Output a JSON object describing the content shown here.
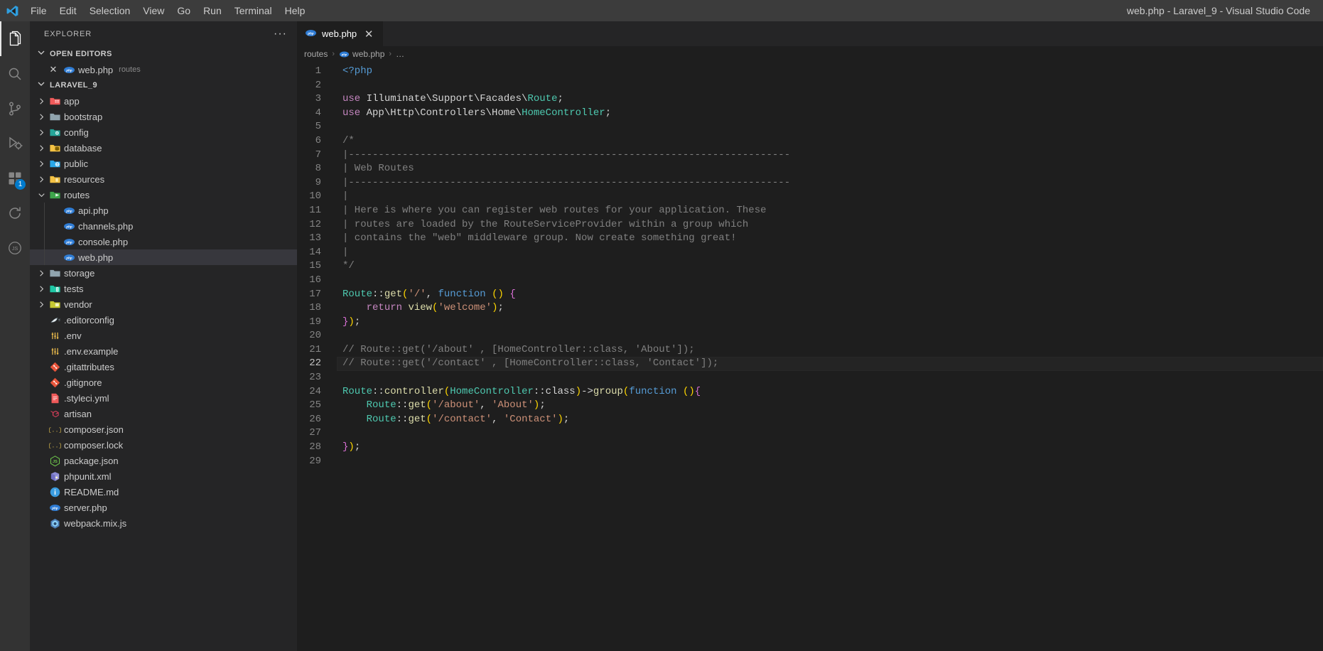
{
  "window": {
    "title": "web.php - Laravel_9 - Visual Studio Code",
    "logo_icon": "vscode-logo-icon"
  },
  "menubar": {
    "items": [
      {
        "label": "File"
      },
      {
        "label": "Edit"
      },
      {
        "label": "Selection"
      },
      {
        "label": "View"
      },
      {
        "label": "Go"
      },
      {
        "label": "Run"
      },
      {
        "label": "Terminal"
      },
      {
        "label": "Help"
      }
    ]
  },
  "activitybar": {
    "items": [
      {
        "name": "explorer",
        "icon": "files-icon",
        "active": true,
        "badge": ""
      },
      {
        "name": "search",
        "icon": "search-icon",
        "active": false,
        "badge": ""
      },
      {
        "name": "source-control",
        "icon": "source-control-icon",
        "active": false,
        "badge": ""
      },
      {
        "name": "run-and-debug",
        "icon": "run-debug-icon",
        "active": false,
        "badge": ""
      },
      {
        "name": "extensions",
        "icon": "extensions-icon",
        "active": false,
        "badge": "1"
      },
      {
        "name": "sync",
        "icon": "sync-icon",
        "active": false,
        "badge": ""
      },
      {
        "name": "json-tools",
        "icon": "json-icon",
        "active": false,
        "badge": ""
      }
    ]
  },
  "sidebar": {
    "title": "EXPLORER",
    "more_label": "···",
    "open_editors": {
      "label": "OPEN EDITORS",
      "expanded": true,
      "items": [
        {
          "name": "web.php",
          "folder": "routes",
          "icon": "php-file-icon",
          "close_label": "✕"
        }
      ]
    },
    "workspace": {
      "label": "LARAVEL_9",
      "expanded": true,
      "items": [
        {
          "label": "app",
          "type": "folder",
          "icon": "folder-app-icon",
          "expanded": false,
          "depth": 1
        },
        {
          "label": "bootstrap",
          "type": "folder",
          "icon": "folder-plain-icon",
          "expanded": false,
          "depth": 1
        },
        {
          "label": "config",
          "type": "folder",
          "icon": "folder-config-icon",
          "expanded": false,
          "depth": 1
        },
        {
          "label": "database",
          "type": "folder",
          "icon": "folder-database-icon",
          "expanded": false,
          "depth": 1
        },
        {
          "label": "public",
          "type": "folder",
          "icon": "folder-public-icon",
          "expanded": false,
          "depth": 1
        },
        {
          "label": "resources",
          "type": "folder",
          "icon": "folder-resource-icon",
          "expanded": false,
          "depth": 1
        },
        {
          "label": "routes",
          "type": "folder",
          "icon": "folder-routes-icon",
          "expanded": true,
          "depth": 1
        },
        {
          "label": "api.php",
          "type": "file",
          "icon": "php-file-icon",
          "depth": 2
        },
        {
          "label": "channels.php",
          "type": "file",
          "icon": "php-file-icon",
          "depth": 2
        },
        {
          "label": "console.php",
          "type": "file",
          "icon": "php-file-icon",
          "depth": 2
        },
        {
          "label": "web.php",
          "type": "file",
          "icon": "php-file-icon",
          "depth": 2,
          "selected": true
        },
        {
          "label": "storage",
          "type": "folder",
          "icon": "folder-plain-icon",
          "expanded": false,
          "depth": 1
        },
        {
          "label": "tests",
          "type": "folder",
          "icon": "folder-tests-icon",
          "expanded": false,
          "depth": 1
        },
        {
          "label": "vendor",
          "type": "folder",
          "icon": "folder-vendor-icon",
          "expanded": false,
          "depth": 1
        },
        {
          "label": ".editorconfig",
          "type": "file",
          "icon": "editorconfig-icon",
          "depth": 1
        },
        {
          "label": ".env",
          "type": "file",
          "icon": "env-icon",
          "depth": 1
        },
        {
          "label": ".env.example",
          "type": "file",
          "icon": "env-icon",
          "depth": 1
        },
        {
          "label": ".gitattributes",
          "type": "file",
          "icon": "git-icon",
          "depth": 1
        },
        {
          "label": ".gitignore",
          "type": "file",
          "icon": "git-icon",
          "depth": 1
        },
        {
          "label": ".styleci.yml",
          "type": "file",
          "icon": "yml-icon",
          "depth": 1
        },
        {
          "label": "artisan",
          "type": "file",
          "icon": "laravel-icon",
          "depth": 1
        },
        {
          "label": "composer.json",
          "type": "file",
          "icon": "composer-icon",
          "depth": 1
        },
        {
          "label": "composer.lock",
          "type": "file",
          "icon": "composer-icon",
          "depth": 1
        },
        {
          "label": "package.json",
          "type": "file",
          "icon": "nodejs-icon",
          "depth": 1
        },
        {
          "label": "phpunit.xml",
          "type": "file",
          "icon": "phpunit-icon",
          "depth": 1
        },
        {
          "label": "README.md",
          "type": "file",
          "icon": "readme-icon",
          "depth": 1
        },
        {
          "label": "server.php",
          "type": "file",
          "icon": "php-file-icon",
          "depth": 1
        },
        {
          "label": "webpack.mix.js",
          "type": "file",
          "icon": "webpack-icon",
          "depth": 1
        }
      ]
    }
  },
  "editor": {
    "tabs": [
      {
        "label": "web.php",
        "icon": "php-file-icon",
        "active": true,
        "close_label": "✕"
      }
    ],
    "breadcrumb": [
      "routes",
      "web.php",
      "…"
    ],
    "active_line": 22,
    "total_lines": 29,
    "lines": [
      {
        "n": 1,
        "text": "<?php"
      },
      {
        "n": 2,
        "text": ""
      },
      {
        "n": 3,
        "text": "use Illuminate\\Support\\Facades\\Route;"
      },
      {
        "n": 4,
        "text": "use App\\Http\\Controllers\\Home\\HomeController;"
      },
      {
        "n": 5,
        "text": ""
      },
      {
        "n": 6,
        "text": "/*"
      },
      {
        "n": 7,
        "text": "|--------------------------------------------------------------------------"
      },
      {
        "n": 8,
        "text": "| Web Routes"
      },
      {
        "n": 9,
        "text": "|--------------------------------------------------------------------------"
      },
      {
        "n": 10,
        "text": "|"
      },
      {
        "n": 11,
        "text": "| Here is where you can register web routes for your application. These"
      },
      {
        "n": 12,
        "text": "| routes are loaded by the RouteServiceProvider within a group which"
      },
      {
        "n": 13,
        "text": "| contains the \"web\" middleware group. Now create something great!"
      },
      {
        "n": 14,
        "text": "|"
      },
      {
        "n": 15,
        "text": "*/"
      },
      {
        "n": 16,
        "text": ""
      },
      {
        "n": 17,
        "text": "Route::get('/', function () {"
      },
      {
        "n": 18,
        "text": "    return view('welcome');"
      },
      {
        "n": 19,
        "text": "});"
      },
      {
        "n": 20,
        "text": ""
      },
      {
        "n": 21,
        "text": "// Route::get('/about' , [HomeController::class, 'About']);"
      },
      {
        "n": 22,
        "text": "// Route::get('/contact' , [HomeController::class, 'Contact']);"
      },
      {
        "n": 23,
        "text": ""
      },
      {
        "n": 24,
        "text": "Route::controller(HomeController::class)->group(function (){"
      },
      {
        "n": 25,
        "text": "    Route::get('/about', 'About');"
      },
      {
        "n": 26,
        "text": "    Route::get('/contact', 'Contact');"
      },
      {
        "n": 27,
        "text": ""
      },
      {
        "n": 28,
        "text": "});"
      },
      {
        "n": 29,
        "text": ""
      }
    ]
  },
  "colors": {
    "titlebar_bg": "#3c3c3c",
    "activitybar_bg": "#333333",
    "sidebar_bg": "#252526",
    "editor_bg": "#1e1e1e",
    "accent": "#007acc",
    "selection_bg": "#37373d",
    "php_icon": "#4f5b93",
    "laravel_red": "#e74430",
    "keyword_purple": "#c586c0",
    "keyword_blue": "#569cd6",
    "class_teal": "#4ec9b0",
    "string_orange": "#ce9178",
    "comment_grey": "#808080",
    "function_yellow": "#dcdcaa"
  }
}
